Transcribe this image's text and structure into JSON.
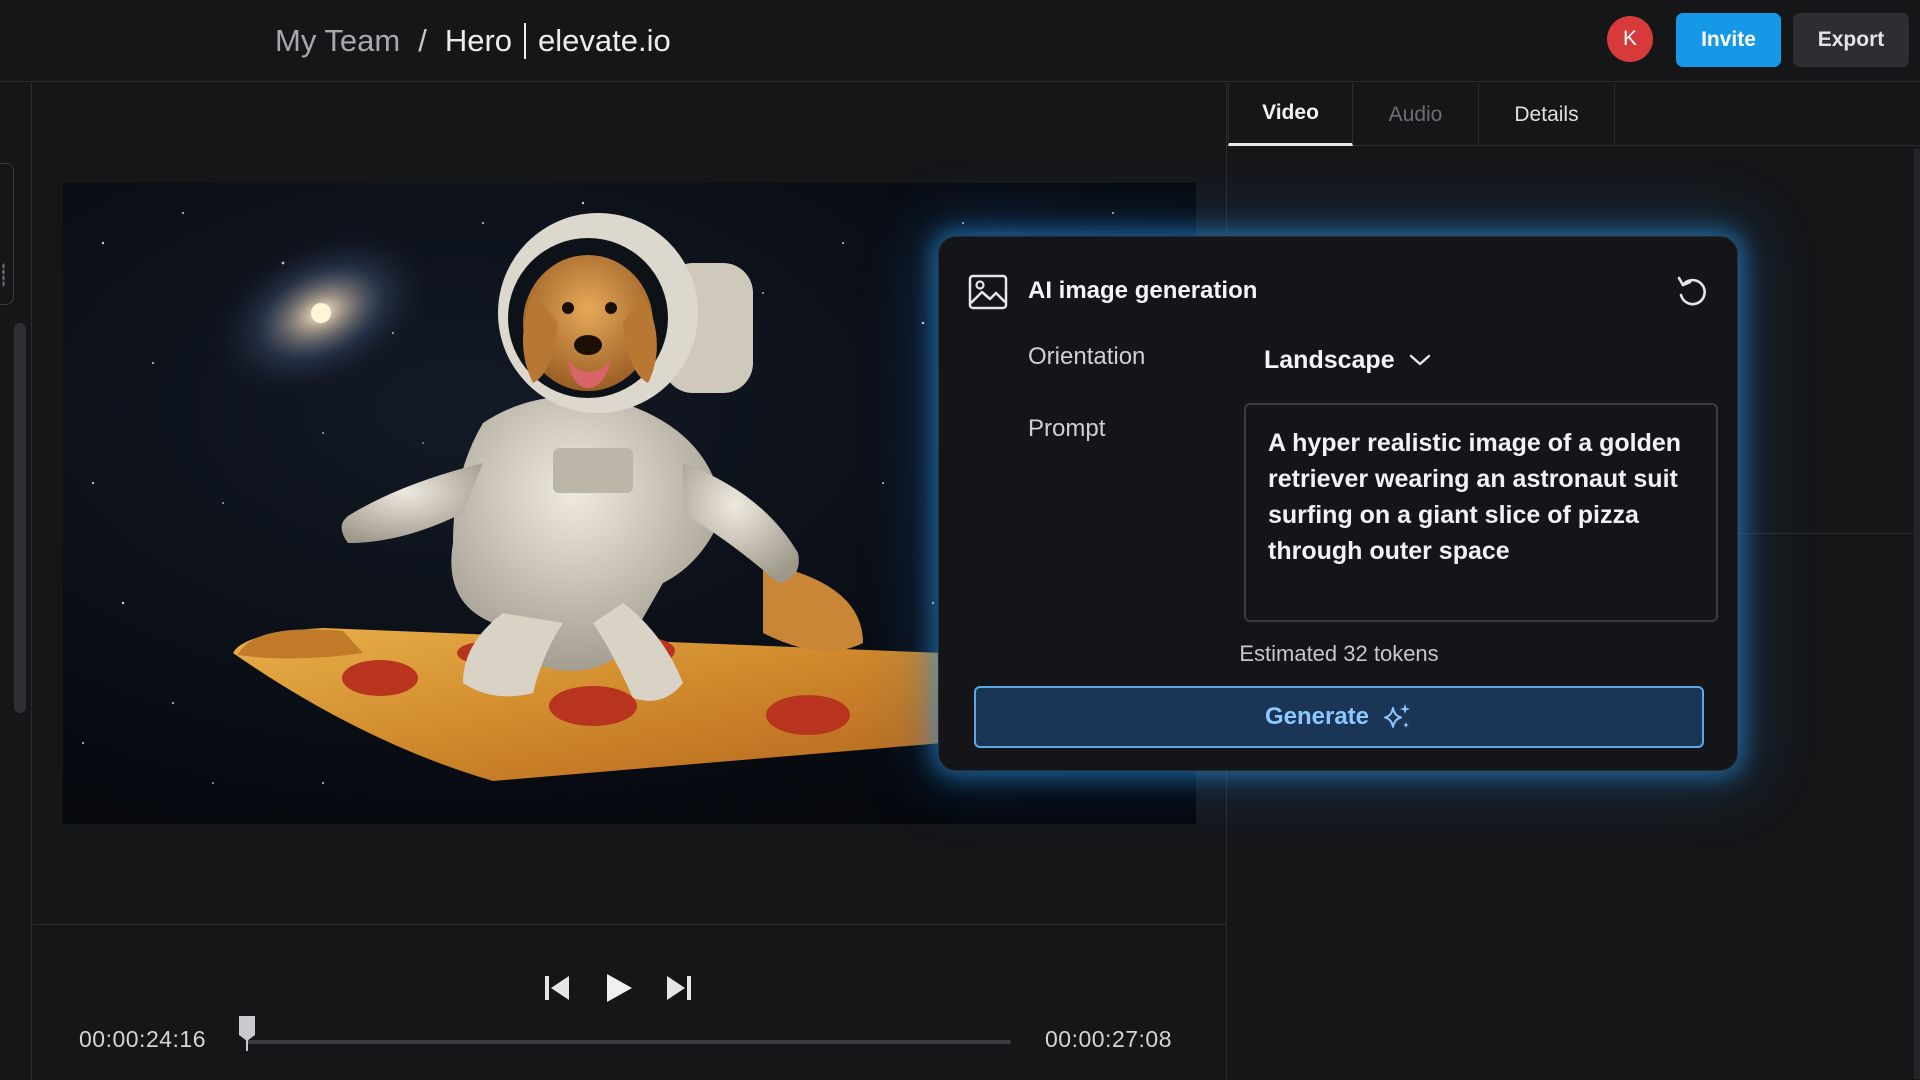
{
  "header": {
    "breadcrumb_team": "My Team",
    "breadcrumb_separator": "/",
    "breadcrumb_project": "Hero",
    "breadcrumb_file": "elevate.io",
    "avatar_initial": "K",
    "invite_label": "Invite",
    "export_label": "Export"
  },
  "player": {
    "current_time": "00:00:24:16",
    "end_time": "00:00:27:08",
    "progress_fraction": 0.0
  },
  "tabs": [
    {
      "label": "Video",
      "active": true
    },
    {
      "label": "Audio",
      "active": false
    },
    {
      "label": "Details",
      "active": false
    }
  ],
  "ai_generation": {
    "title": "AI image generation",
    "orientation_label": "Orientation",
    "orientation_value": "Landscape",
    "prompt_label": "Prompt",
    "prompt_text": "A hyper realistic image of a golden retriever wearing an astronaut suit surfing on a giant slice of pizza through outer space",
    "tokens_text": "Estimated 32 tokens",
    "generate_label": "Generate"
  },
  "colors": {
    "accent_blue": "#1598e8",
    "avatar_red": "#d63a3a",
    "generate_text": "#8cc8ff",
    "glow": "#2896e6"
  },
  "icons": {
    "card": "image-icon",
    "reset": "reset-icon",
    "dropdown": "chevron-down-icon",
    "generate": "sparkle-icon",
    "prev": "skip-back-icon",
    "play": "play-icon",
    "next": "skip-forward-icon"
  }
}
